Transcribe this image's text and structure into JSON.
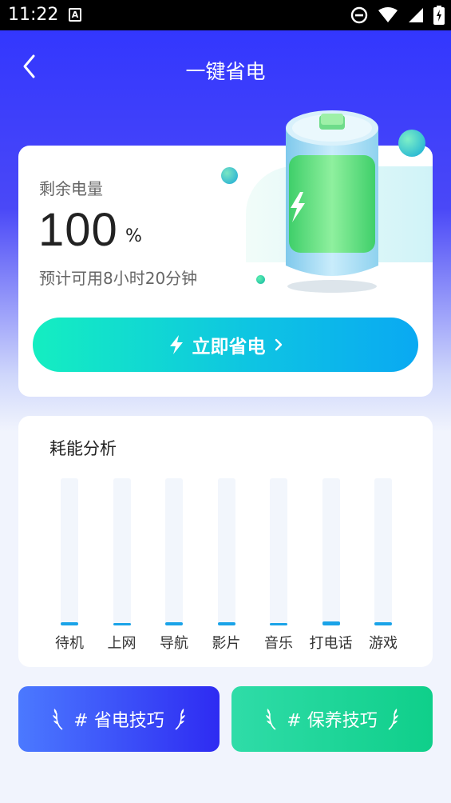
{
  "status_bar": {
    "time": "11:22",
    "notification_badge": "A"
  },
  "header": {
    "title": "一键省电"
  },
  "battery": {
    "label": "剩余电量",
    "value": "100",
    "unit": "%",
    "estimate": "预计可用8小时20分钟",
    "action_label": "立即省电"
  },
  "analysis": {
    "title": "耗能分析",
    "items": [
      {
        "label": "待机",
        "level": 0.02
      },
      {
        "label": "上网",
        "level": 0.01
      },
      {
        "label": "导航",
        "level": 0.02
      },
      {
        "label": "影片",
        "level": 0.02
      },
      {
        "label": "音乐",
        "level": 0.01
      },
      {
        "label": "打电话",
        "level": 0.025
      },
      {
        "label": "游戏",
        "level": 0.02
      }
    ]
  },
  "tips": {
    "power_saving": "# 省电技巧",
    "maintenance": "# 保养技巧"
  },
  "colors": {
    "header_blue": "#2f34ff",
    "accent_cyan": "#0ec2e4",
    "accent_green": "#14eec1",
    "bar_blue": "#1aa3e8"
  },
  "icons": [
    "back-icon",
    "lightning-icon",
    "chevron-right-icon",
    "laurel-icon",
    "battery-illustration"
  ]
}
